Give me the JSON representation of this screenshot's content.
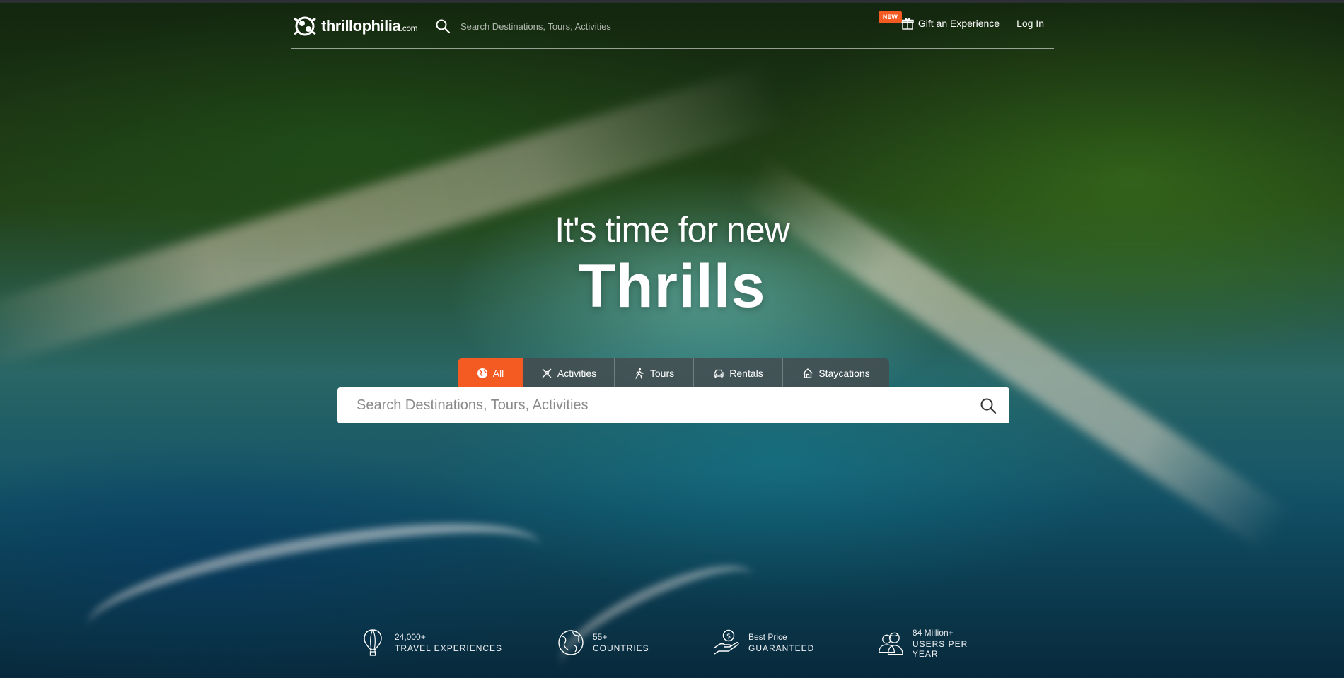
{
  "header": {
    "logo_text": "thrillophilia",
    "logo_suffix": ".com",
    "search_placeholder": "Search Destinations, Tours, Activities",
    "new_badge": "NEW",
    "gift_label": "Gift an Experience",
    "login_label": "Log In"
  },
  "hero": {
    "line1": "It's time for new",
    "line2": "Thrills"
  },
  "tabs": [
    {
      "label": "All",
      "icon": "globe-icon",
      "active": true
    },
    {
      "label": "Activities",
      "icon": "activities-icon",
      "active": false
    },
    {
      "label": "Tours",
      "icon": "hiker-icon",
      "active": false
    },
    {
      "label": "Rentals",
      "icon": "car-icon",
      "active": false
    },
    {
      "label": "Staycations",
      "icon": "house-icon",
      "active": false
    }
  ],
  "search": {
    "placeholder": "Search Destinations, Tours, Activities"
  },
  "stats": [
    {
      "top": "24,000+",
      "bottom": "TRAVEL EXPERIENCES",
      "icon": "hot-air-balloon-icon"
    },
    {
      "top": "55+",
      "bottom": "COUNTRIES",
      "icon": "globe-icon"
    },
    {
      "top": "Best Price",
      "bottom": "GUARANTEED",
      "icon": "price-hand-icon"
    },
    {
      "top": "84 Million+",
      "bottom": "USERS PER YEAR",
      "icon": "users-icon"
    }
  ],
  "colors": {
    "accent": "#f35b22",
    "tab_bg": "#464b4e"
  }
}
